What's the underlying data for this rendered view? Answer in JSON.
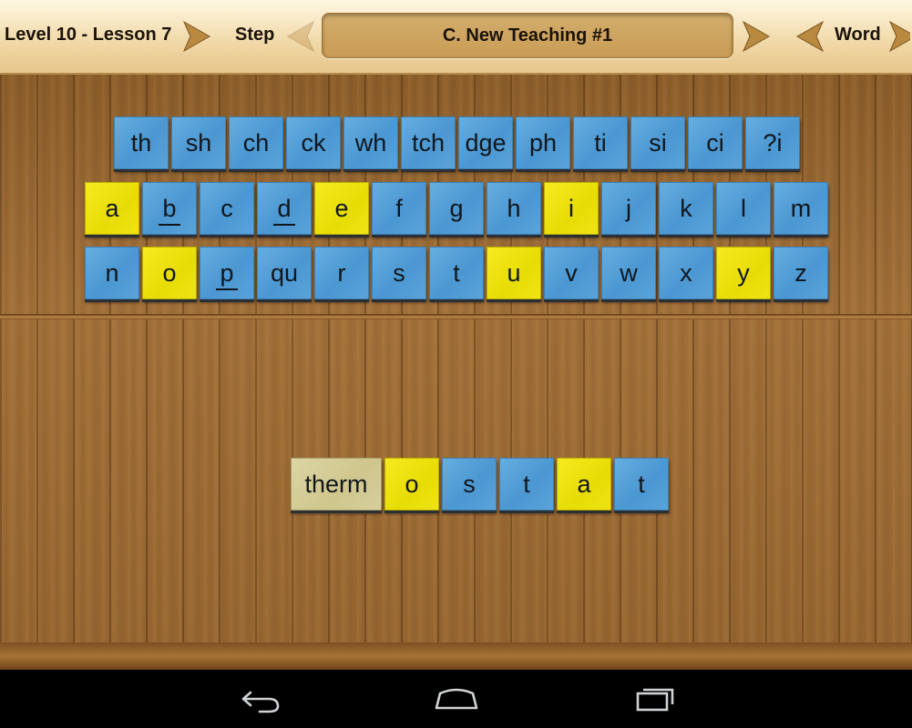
{
  "header": {
    "level_lesson": "Level 10 - Lesson 7",
    "step_label": "Step",
    "title": "C. New Teaching #1",
    "word_label": "Word"
  },
  "keyboard": {
    "row1": [
      {
        "label": "th",
        "color": "blue"
      },
      {
        "label": "sh",
        "color": "blue"
      },
      {
        "label": "ch",
        "color": "blue"
      },
      {
        "label": "ck",
        "color": "blue"
      },
      {
        "label": "wh",
        "color": "blue"
      },
      {
        "label": "tch",
        "color": "blue"
      },
      {
        "label": "dge",
        "color": "blue"
      },
      {
        "label": "ph",
        "color": "blue"
      },
      {
        "label": "ti",
        "color": "blue"
      },
      {
        "label": "si",
        "color": "blue"
      },
      {
        "label": "ci",
        "color": "blue"
      },
      {
        "label": "?i",
        "color": "blue"
      }
    ],
    "row2": [
      {
        "label": "a",
        "color": "yellow"
      },
      {
        "label": "b",
        "color": "blue",
        "underlined": true
      },
      {
        "label": "c",
        "color": "blue"
      },
      {
        "label": "d",
        "color": "blue",
        "underlined": true
      },
      {
        "label": "e",
        "color": "yellow"
      },
      {
        "label": "f",
        "color": "blue"
      },
      {
        "label": "g",
        "color": "blue"
      },
      {
        "label": "h",
        "color": "blue"
      },
      {
        "label": "i",
        "color": "yellow"
      },
      {
        "label": "j",
        "color": "blue"
      },
      {
        "label": "k",
        "color": "blue"
      },
      {
        "label": "l",
        "color": "blue"
      },
      {
        "label": "m",
        "color": "blue"
      }
    ],
    "row3": [
      {
        "label": "n",
        "color": "blue"
      },
      {
        "label": "o",
        "color": "yellow"
      },
      {
        "label": "p",
        "color": "blue",
        "underlined": true
      },
      {
        "label": "qu",
        "color": "blue"
      },
      {
        "label": "r",
        "color": "blue"
      },
      {
        "label": "s",
        "color": "blue"
      },
      {
        "label": "t",
        "color": "blue"
      },
      {
        "label": "u",
        "color": "yellow"
      },
      {
        "label": "v",
        "color": "blue"
      },
      {
        "label": "w",
        "color": "blue"
      },
      {
        "label": "x",
        "color": "blue"
      },
      {
        "label": "y",
        "color": "yellow"
      },
      {
        "label": "z",
        "color": "blue"
      }
    ]
  },
  "word": [
    {
      "label": "therm",
      "color": "tan"
    },
    {
      "label": "o",
      "color": "yellow"
    },
    {
      "label": "s",
      "color": "blue"
    },
    {
      "label": "t",
      "color": "blue"
    },
    {
      "label": "a",
      "color": "yellow"
    },
    {
      "label": "t",
      "color": "blue"
    }
  ],
  "colors": {
    "blue": "#4b97d2",
    "yellow": "#e8dc05",
    "tan": "#cfc68d",
    "arrow": "#b9893f"
  },
  "icons": {
    "header_arrows": [
      "lesson-next-arrow-icon",
      "step-prev-arrow-icon",
      "step-next-arrow-icon",
      "word-prev-arrow-icon",
      "word-next-arrow-icon"
    ],
    "nav": [
      "back-icon",
      "home-icon",
      "recent-apps-icon"
    ]
  }
}
